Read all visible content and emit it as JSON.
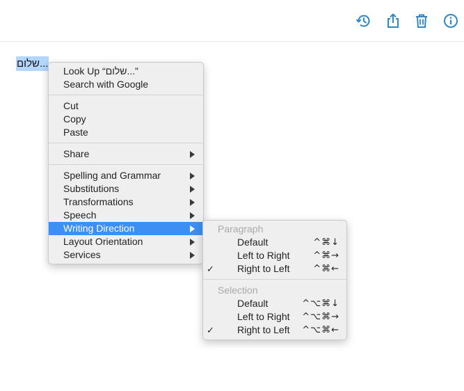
{
  "toolbar": {
    "icons": [
      "history-icon",
      "share-icon",
      "trash-icon",
      "info-icon"
    ],
    "accent_color": "#2f86c9"
  },
  "document": {
    "selected_text": "שלום..."
  },
  "context_menu": {
    "look_up": "Look Up “שלום...”",
    "search_google": "Search with Google",
    "cut": "Cut",
    "copy": "Copy",
    "paste": "Paste",
    "share": "Share",
    "spelling": "Spelling and Grammar",
    "substitutions": "Substitutions",
    "transformations": "Transformations",
    "speech": "Speech",
    "writing_direction": "Writing Direction",
    "layout_orientation": "Layout Orientation",
    "services": "Services",
    "highlight_color": "#3d8ff4"
  },
  "submenu": {
    "paragraph_header": "Paragraph",
    "paragraph_items": [
      {
        "label": "Default",
        "shortcut": "^⌘↓",
        "checked": false
      },
      {
        "label": "Left to Right",
        "shortcut": "^⌘→",
        "checked": false
      },
      {
        "label": "Right to Left",
        "shortcut": "^⌘←",
        "checked": true
      }
    ],
    "selection_header": "Selection",
    "selection_items": [
      {
        "label": "Default",
        "shortcut": "^⌥⌘↓",
        "checked": false
      },
      {
        "label": "Left to Right",
        "shortcut": "^⌥⌘→",
        "checked": false
      },
      {
        "label": "Right to Left",
        "shortcut": "^⌥⌘←",
        "checked": true
      }
    ],
    "check_mark": "✓"
  }
}
